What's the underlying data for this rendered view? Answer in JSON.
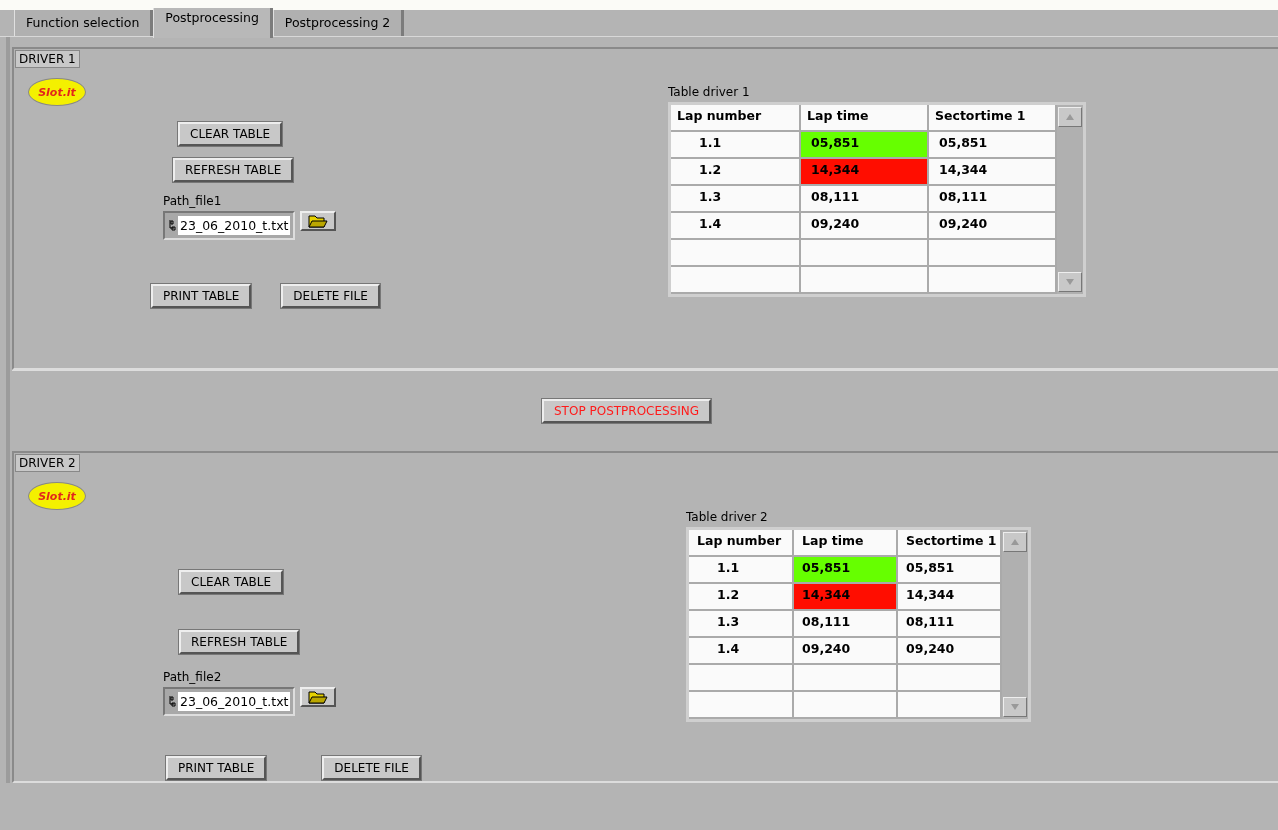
{
  "tabs": [
    {
      "label": "Function selection",
      "selected": false
    },
    {
      "label": "Postprocessing",
      "selected": true
    },
    {
      "label": "Postprocessing 2",
      "selected": false
    }
  ],
  "drivers": [
    {
      "label": "DRIVER 1",
      "logo_text": "Slot.it",
      "clear_button": "CLEAR TABLE",
      "refresh_button": "REFRESH TABLE",
      "path_label": "Path_file1",
      "path_value": "23_06_2010_t.txt",
      "print_button": "PRINT TABLE",
      "delete_button": "DELETE FILE",
      "table": {
        "title": "Table driver 1",
        "columns": [
          "Lap number",
          "Lap time",
          "Sectortime 1"
        ],
        "rows": [
          {
            "cells": [
              {
                "text": "1.1"
              },
              {
                "text": "05,851",
                "color": "#66ff00"
              },
              {
                "text": "05,851"
              }
            ]
          },
          {
            "cells": [
              {
                "text": "1.2"
              },
              {
                "text": "14,344",
                "color": "#ff0d00"
              },
              {
                "text": "14,344"
              }
            ]
          },
          {
            "cells": [
              {
                "text": "1.3"
              },
              {
                "text": "08,111"
              },
              {
                "text": "08,111"
              }
            ]
          },
          {
            "cells": [
              {
                "text": "1.4"
              },
              {
                "text": "09,240"
              },
              {
                "text": "09,240"
              }
            ]
          }
        ]
      }
    },
    {
      "label": "DRIVER 2",
      "logo_text": "Slot.it",
      "clear_button": "CLEAR TABLE",
      "refresh_button": "REFRESH TABLE",
      "path_label": "Path_file2",
      "path_value": "23_06_2010_t.txt",
      "print_button": "PRINT TABLE",
      "delete_button": "DELETE FILE",
      "table": {
        "title": "Table driver 2",
        "columns": [
          "Lap number",
          "Lap time",
          "Sectortime 1"
        ],
        "rows": [
          {
            "cells": [
              {
                "text": "1.1"
              },
              {
                "text": "05,851",
                "color": "#66ff00"
              },
              {
                "text": "05,851"
              }
            ]
          },
          {
            "cells": [
              {
                "text": "1.2"
              },
              {
                "text": "14,344",
                "color": "#ff0d00"
              },
              {
                "text": "14,344"
              }
            ]
          },
          {
            "cells": [
              {
                "text": "1.3"
              },
              {
                "text": "08,111"
              },
              {
                "text": "08,111"
              }
            ]
          },
          {
            "cells": [
              {
                "text": "1.4"
              },
              {
                "text": "09,240"
              },
              {
                "text": "09,240"
              }
            ]
          }
        ]
      }
    }
  ],
  "stop_button": "STOP POSTPROCESSING"
}
